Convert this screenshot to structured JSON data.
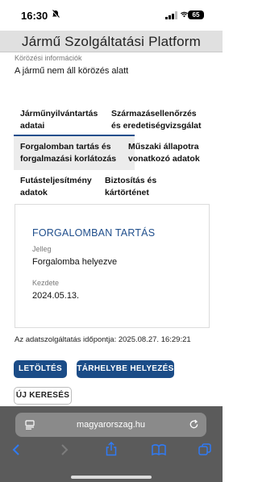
{
  "status_bar": {
    "time": "16:30",
    "battery": "65"
  },
  "header": {
    "title": "Jármű Szolgáltatási Platform"
  },
  "tracking": {
    "label": "Körözési információk",
    "value": "A jármű nem áll körözés alatt"
  },
  "tabs": [
    {
      "line1": "Járműnyilvántartás",
      "line2": "adatai"
    },
    {
      "line1": "Származásellenőrzés",
      "line2": "és eredetiségvizsgálat"
    },
    {
      "line1": "Forgalomban tartás és",
      "line2": "forgalmazási korlátozás"
    },
    {
      "line1": "Műszaki állapotra",
      "line2": "vonatkozó adatok"
    },
    {
      "line1": "Futásteljesítmény",
      "line2": "adatok"
    },
    {
      "line1": "Biztosítás és",
      "line2": "kártörténet"
    }
  ],
  "card": {
    "title": "FORGALOMBAN TARTÁS",
    "field1_label": "Jelleg",
    "field1_value": "Forgalomba helyezve",
    "field2_label": "Kezdete",
    "field2_value": "2024.05.13."
  },
  "timestamp": "Az adatszolgáltatás időpontja: 2025.08.27. 16:29:21",
  "buttons": {
    "download": "LETÖLTÉS",
    "store": "TÁRHELYBE HELYEZÉS",
    "new_search": "ÚJ KERESÉS"
  },
  "browser": {
    "url": "magyarorszag.hu"
  },
  "colors": {
    "primary": "#1b4c87",
    "accent_text": "#1f4e8c",
    "browser_bar": "#5b5b5b",
    "link_icon": "#2f7bf6"
  }
}
